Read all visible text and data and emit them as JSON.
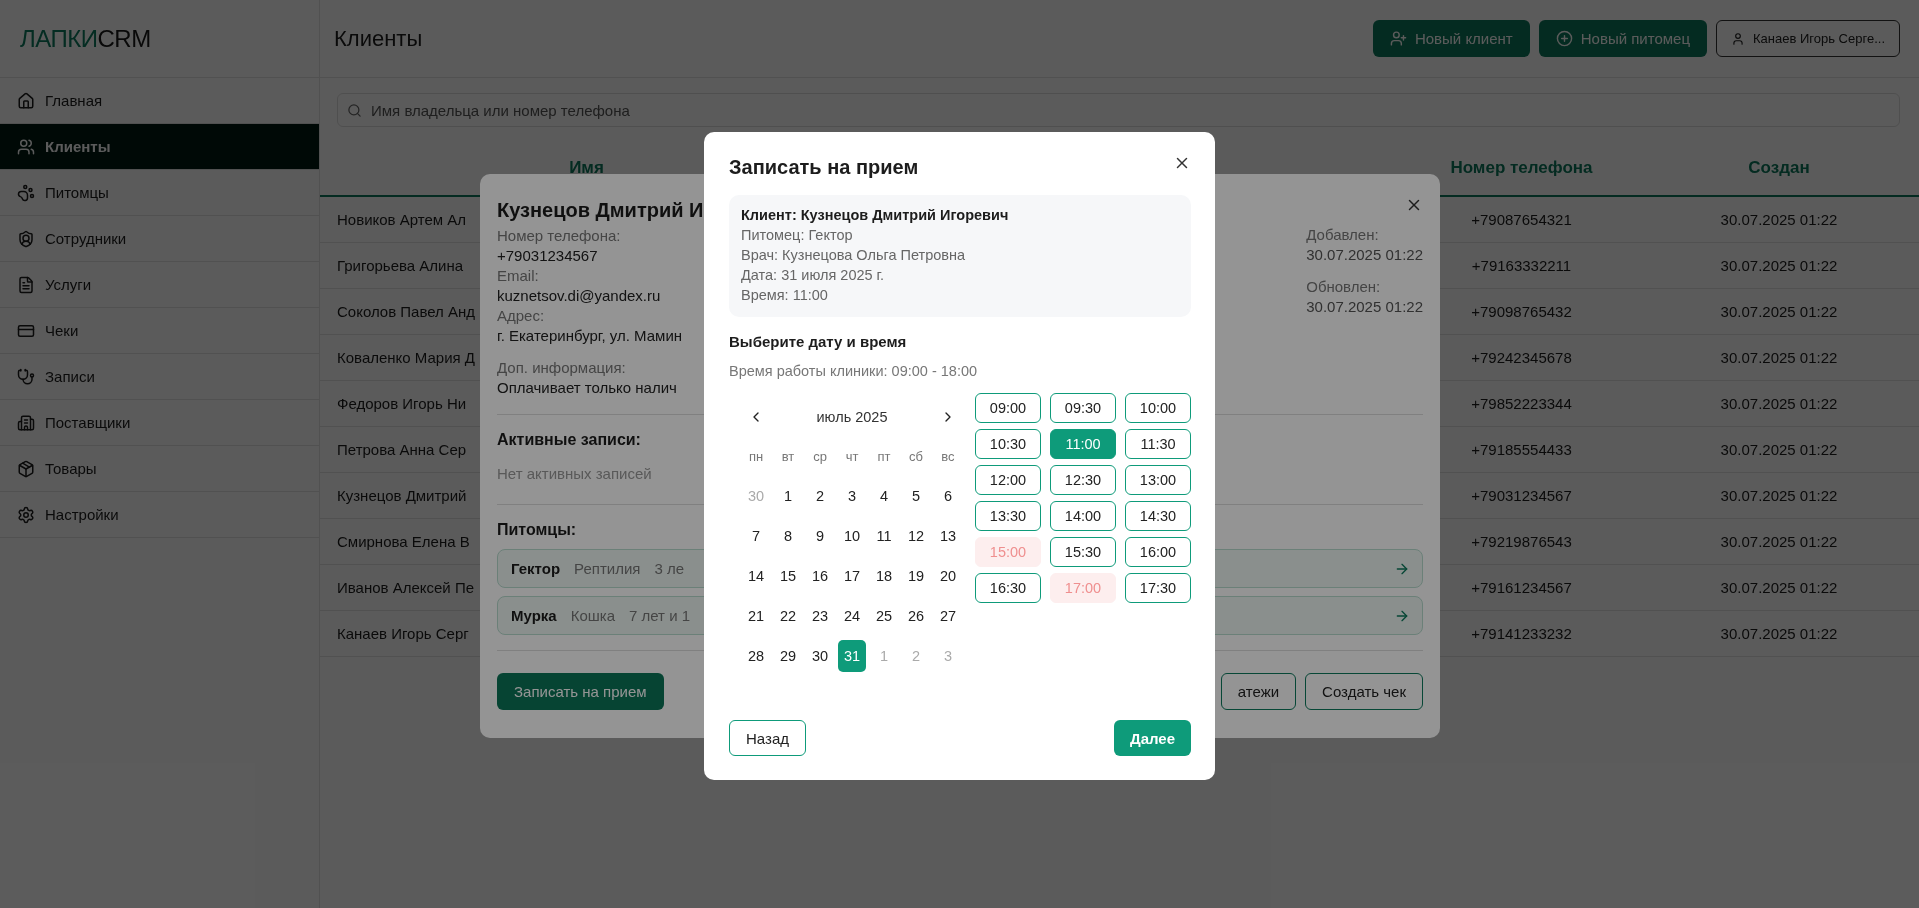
{
  "logo": {
    "main": "ЛАПКИ",
    "accent": "CRM"
  },
  "sidebar": {
    "items": [
      {
        "label": "Главная",
        "selected": false
      },
      {
        "label": "Клиенты",
        "selected": true
      },
      {
        "label": "Питомцы",
        "selected": false
      },
      {
        "label": "Сотрудники",
        "selected": false
      },
      {
        "label": "Услуги",
        "selected": false
      },
      {
        "label": "Чеки",
        "selected": false
      },
      {
        "label": "Записи",
        "selected": false
      },
      {
        "label": "Поставщики",
        "selected": false
      },
      {
        "label": "Товары",
        "selected": false
      },
      {
        "label": "Настройки",
        "selected": false
      }
    ]
  },
  "header": {
    "title": "Клиенты",
    "buttons": [
      {
        "label": "Новый клиент",
        "kind": "add-user"
      },
      {
        "label": "Новый питомец",
        "kind": "add"
      }
    ],
    "user": "Канаев Игорь Серге..."
  },
  "search": {
    "placeholder": "Имя владельца или номер телефона"
  },
  "table": {
    "columns": [
      "Имя",
      "Номер телефона",
      "Создан"
    ],
    "rows": [
      {
        "name": "Новиков Артем Ал",
        "phone": "+79087654321",
        "created": "30.07.2025 01:22"
      },
      {
        "name": "Григорьева Алина",
        "phone": "+79163332211",
        "created": "30.07.2025 01:22"
      },
      {
        "name": "Соколов Павел Анд",
        "phone": "+79098765432",
        "created": "30.07.2025 01:22"
      },
      {
        "name": "Коваленко Мария Д",
        "phone": "+79242345678",
        "created": "30.07.2025 01:22"
      },
      {
        "name": "Федоров Игорь Ни",
        "phone": "+79852223344",
        "created": "30.07.2025 01:22"
      },
      {
        "name": "Петрова Анна Сер",
        "phone": "+79185554433",
        "created": "30.07.2025 01:22"
      },
      {
        "name": "Кузнецов Дмитрий",
        "phone": "+79031234567",
        "created": "30.07.2025 01:22"
      },
      {
        "name": "Смирнова Елена В",
        "phone": "+79219876543",
        "created": "30.07.2025 01:22"
      },
      {
        "name": "Иванов Алексей Пе",
        "phone": "+79161234567",
        "created": "30.07.2025 01:22"
      },
      {
        "name": "Канаев Игорь Серг",
        "phone": "+79141233232",
        "created": "30.07.2025 01:22"
      }
    ]
  },
  "client_card": {
    "title": "Кузнецов Дмитрий И",
    "fields": [
      {
        "label": "Номер телефона:",
        "value": "+79031234567"
      },
      {
        "label": "Email:",
        "value": "kuznetsov.di@yandex.ru"
      },
      {
        "label": "Адрес:",
        "value": "г. Екатеринбург, ул. Мамин"
      },
      {
        "label": "Доп. информация:",
        "value": "Оплачивает только налич"
      }
    ],
    "meta": [
      {
        "label": "Добавлен:",
        "value": "30.07.2025 01:22"
      },
      {
        "label": "Обновлен:",
        "value": "30.07.2025 01:22"
      }
    ],
    "active_title": "Активные записи:",
    "active_empty": "Нет активных записей",
    "pets_title": "Питомцы:",
    "pets": [
      {
        "name": "Гектор",
        "species": "Рептилия",
        "age": "3 ле"
      },
      {
        "name": "Мурка",
        "species": "Кошка",
        "age": "7 лет и 1"
      }
    ],
    "actions": [
      {
        "label": "Записать на прием",
        "kind": "primary"
      },
      {
        "label": "атежи",
        "kind": "outline"
      },
      {
        "label": "Создать чек",
        "kind": "outline"
      }
    ]
  },
  "appointment_dialog": {
    "title": "Записать на прием",
    "summary": [
      {
        "text": "Клиент: Кузнецов Дмитрий Игоревич",
        "kind": "strong"
      },
      {
        "text": "Питомец: Гектор",
        "kind": "plain"
      },
      {
        "text": "Врач: Кузнецова Ольга Петровна",
        "kind": "plain"
      },
      {
        "text": "Дата: 31 июля 2025 г.",
        "kind": "plain"
      },
      {
        "text": "Время: 11:00",
        "kind": "plain"
      }
    ],
    "section_title": "Выберите дату и время",
    "hours": "Время работы клиники: 09:00 - 18:00",
    "calendar": {
      "month": "июль 2025",
      "weekdays": [
        "пн",
        "вт",
        "ср",
        "чт",
        "пт",
        "сб",
        "вс"
      ],
      "days": [
        {
          "day": "30",
          "outside": true,
          "selected": false
        },
        {
          "day": "1",
          "outside": false,
          "selected": false
        },
        {
          "day": "2",
          "outside": false,
          "selected": false
        },
        {
          "day": "3",
          "outside": false,
          "selected": false
        },
        {
          "day": "4",
          "outside": false,
          "selected": false
        },
        {
          "day": "5",
          "outside": false,
          "selected": false
        },
        {
          "day": "6",
          "outside": false,
          "selected": false
        },
        {
          "day": "7",
          "outside": false,
          "selected": false
        },
        {
          "day": "8",
          "outside": false,
          "selected": false
        },
        {
          "day": "9",
          "outside": false,
          "selected": false
        },
        {
          "day": "10",
          "outside": false,
          "selected": false
        },
        {
          "day": "11",
          "outside": false,
          "selected": false
        },
        {
          "day": "12",
          "outside": false,
          "selected": false
        },
        {
          "day": "13",
          "outside": false,
          "selected": false
        },
        {
          "day": "14",
          "outside": false,
          "selected": false
        },
        {
          "day": "15",
          "outside": false,
          "selected": false
        },
        {
          "day": "16",
          "outside": false,
          "selected": false
        },
        {
          "day": "17",
          "outside": false,
          "selected": false
        },
        {
          "day": "18",
          "outside": false,
          "selected": false
        },
        {
          "day": "19",
          "outside": false,
          "selected": false
        },
        {
          "day": "20",
          "outside": false,
          "selected": false
        },
        {
          "day": "21",
          "outside": false,
          "selected": false
        },
        {
          "day": "22",
          "outside": false,
          "selected": false
        },
        {
          "day": "23",
          "outside": false,
          "selected": false
        },
        {
          "day": "24",
          "outside": false,
          "selected": false
        },
        {
          "day": "25",
          "outside": false,
          "selected": false
        },
        {
          "day": "26",
          "outside": false,
          "selected": false
        },
        {
          "day": "27",
          "outside": false,
          "selected": false
        },
        {
          "day": "28",
          "outside": false,
          "selected": false
        },
        {
          "day": "29",
          "outside": false,
          "selected": false
        },
        {
          "day": "30",
          "outside": false,
          "selected": false
        },
        {
          "day": "31",
          "outside": false,
          "selected": true
        },
        {
          "day": "1",
          "outside": true,
          "selected": false
        },
        {
          "day": "2",
          "outside": true,
          "selected": false
        },
        {
          "day": "3",
          "outside": true,
          "selected": false
        }
      ]
    },
    "time_slots": [
      {
        "time": "09:00",
        "selected": false,
        "available": true
      },
      {
        "time": "09:30",
        "selected": false,
        "available": true
      },
      {
        "time": "10:00",
        "selected": false,
        "available": true
      },
      {
        "time": "10:30",
        "selected": false,
        "available": true
      },
      {
        "time": "11:00",
        "selected": true,
        "available": true
      },
      {
        "time": "11:30",
        "selected": false,
        "available": true
      },
      {
        "time": "12:00",
        "selected": false,
        "available": true
      },
      {
        "time": "12:30",
        "selected": false,
        "available": true
      },
      {
        "time": "13:00",
        "selected": false,
        "available": true
      },
      {
        "time": "13:30",
        "selected": false,
        "available": true
      },
      {
        "time": "14:00",
        "selected": false,
        "available": true
      },
      {
        "time": "14:30",
        "selected": false,
        "available": true
      },
      {
        "time": "15:00",
        "selected": false,
        "available": false
      },
      {
        "time": "15:30",
        "selected": false,
        "available": true
      },
      {
        "time": "16:00",
        "selected": false,
        "available": true
      },
      {
        "time": "16:30",
        "selected": false,
        "available": true
      },
      {
        "time": "17:00",
        "selected": false,
        "available": false
      },
      {
        "time": "17:30",
        "selected": false,
        "available": true
      }
    ],
    "back": "Назад",
    "next": "Далее"
  }
}
